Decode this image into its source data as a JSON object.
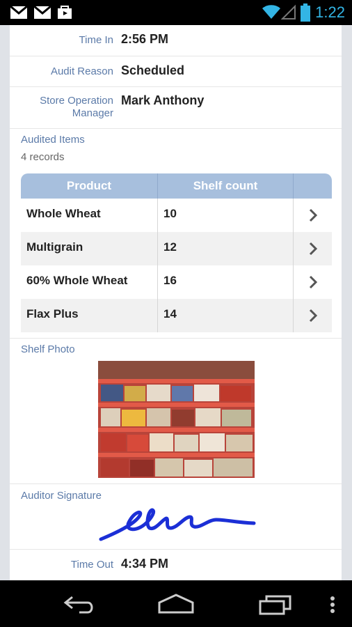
{
  "status_bar": {
    "time": "1:22",
    "icons": [
      "gmail-icon",
      "gmail-icon",
      "bag-icon",
      "wifi-icon",
      "signal-icon",
      "battery-icon"
    ]
  },
  "form": {
    "time_in": {
      "label": "Time In",
      "value": "2:56 PM"
    },
    "audit_reason": {
      "label": "Audit Reason",
      "value": "Scheduled"
    },
    "manager": {
      "label_line1": "Store Operation",
      "label_line2": "Manager",
      "value": "Mark Anthony"
    },
    "audited_items": {
      "title": "Audited Items",
      "records": "4 records",
      "columns": [
        "Product",
        "Shelf count"
      ],
      "rows": [
        {
          "product": "Whole Wheat",
          "count": "10"
        },
        {
          "product": "Multigrain",
          "count": "12"
        },
        {
          "product": "60% Whole Wheat",
          "count": "16"
        },
        {
          "product": "Flax Plus",
          "count": "14"
        }
      ]
    },
    "shelf_photo": {
      "title": "Shelf Photo"
    },
    "signature": {
      "title": "Auditor Signature"
    },
    "time_out": {
      "label": "Time Out",
      "value": "4:34 PM"
    }
  },
  "colors": {
    "accent_label": "#5b7aa8",
    "grid_header": "#a7bfdd",
    "signature_ink": "#1b2fd6",
    "clock": "#33b5e5"
  }
}
